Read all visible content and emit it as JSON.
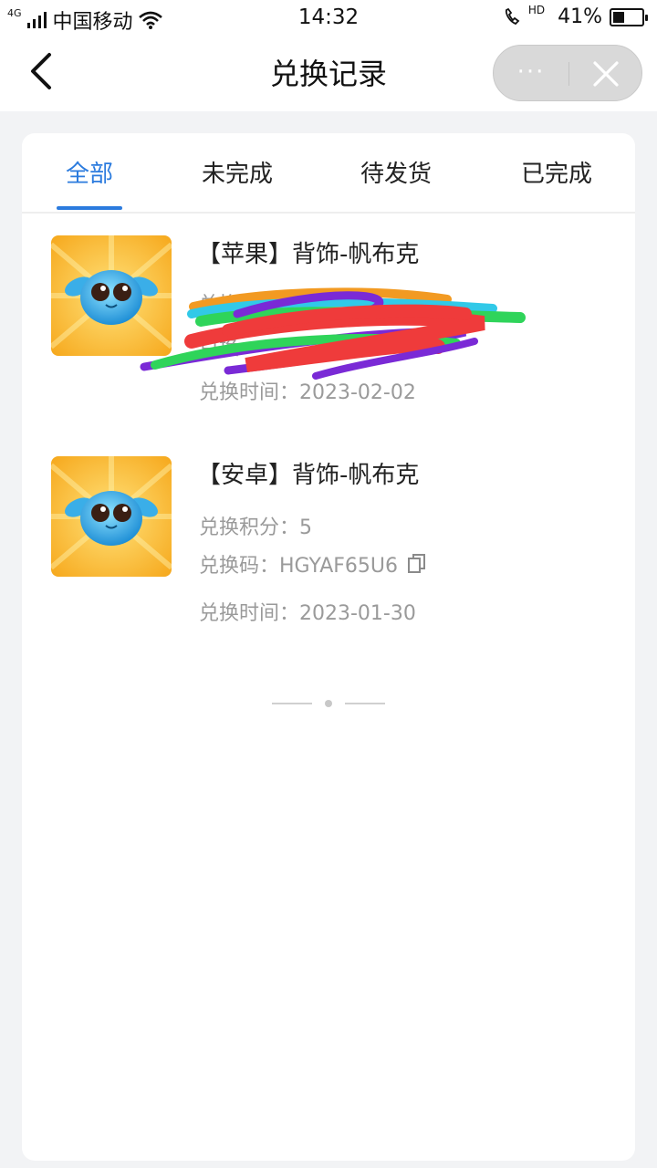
{
  "status_bar": {
    "network": "4G",
    "carrier": "中国移动",
    "time": "14:32",
    "hd_label": "HD",
    "battery_percent": "41%",
    "battery_level": 0.41
  },
  "nav": {
    "title": "兑换记录",
    "more_label": "···"
  },
  "tabs": [
    {
      "label": "全部",
      "active": true
    },
    {
      "label": "未完成",
      "active": false
    },
    {
      "label": "待发货",
      "active": false
    },
    {
      "label": "已完成",
      "active": false
    }
  ],
  "records": [
    {
      "title": "【苹果】背饰-帆布克",
      "points_text": "兑换积分：5",
      "code_text": "兑换",
      "time_text": "兑换时间：2023-02-02",
      "redacted": true
    },
    {
      "title": "【安卓】背饰-帆布克",
      "points_text": "兑换积分：5",
      "code_text": "兑换码：HGYAF65U6",
      "time_text": "兑换时间：2023-01-30",
      "redacted": false
    }
  ],
  "colors": {
    "accent": "#2b7bde",
    "muted_text": "#9a9a9a",
    "background": "#f2f3f5"
  }
}
